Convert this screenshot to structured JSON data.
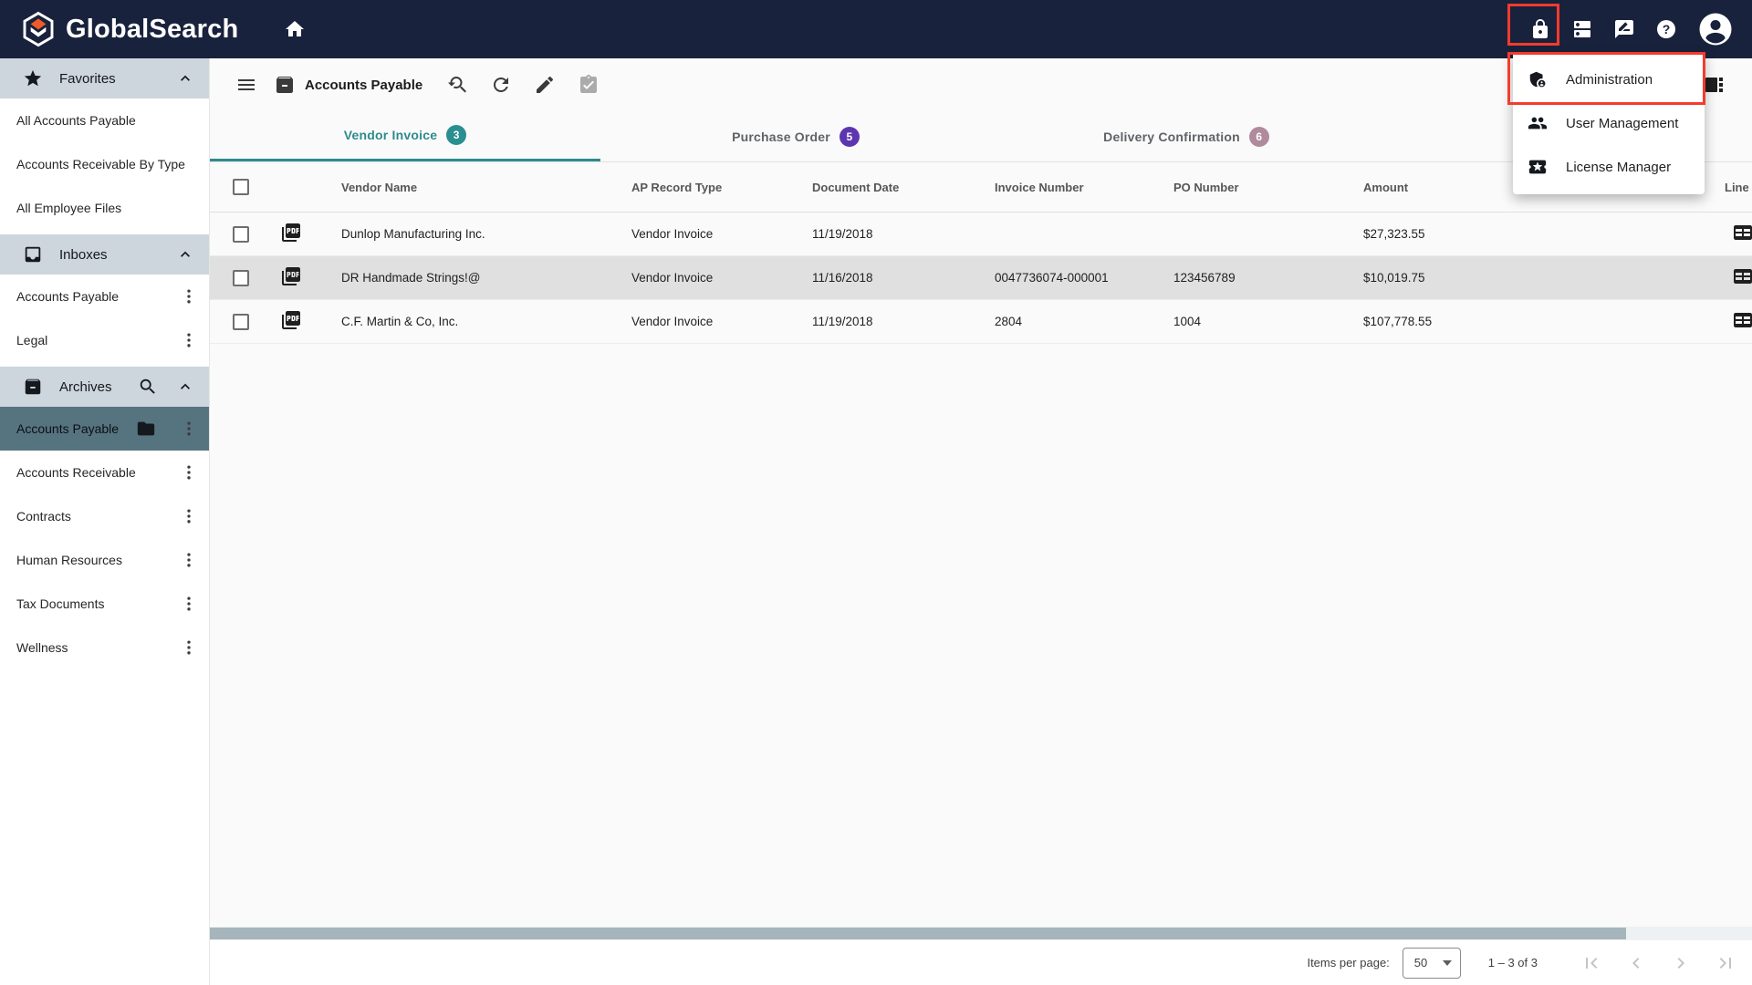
{
  "colors": {
    "topbar_navy": "#19223C",
    "accent_teal": "#2E8B8D",
    "badge_purple": "#5E35B1",
    "badge_mauve": "#B08B9B",
    "annotation_red": "#F43B2E",
    "selected_sidebar_item": "#567380",
    "section_header_bg": "#CDD6DD",
    "row_highlight": "#E0E0E0",
    "scrollbar_thumb": "#A6B5BC"
  },
  "topbar": {
    "brand": "GlobalSearch"
  },
  "account_menu": {
    "items": [
      {
        "label": "Administration",
        "icon": "admin-shield-icon",
        "annotated": true
      },
      {
        "label": "User Management",
        "icon": "user-group-icon"
      },
      {
        "label": "License Manager",
        "icon": "license-ticket-icon"
      }
    ]
  },
  "sidebar": {
    "favorites": {
      "label": "Favorites",
      "items": [
        "All Accounts Payable",
        "Accounts Receivable By Type",
        "All Employee Files"
      ]
    },
    "inboxes": {
      "label": "Inboxes",
      "items": [
        "Accounts Payable",
        "Legal"
      ]
    },
    "archives": {
      "label": "Archives",
      "selected": "Accounts Payable",
      "items": [
        "Accounts Payable",
        "Accounts Receivable",
        "Contracts",
        "Human Resources",
        "Tax Documents",
        "Wellness"
      ]
    }
  },
  "toolbar": {
    "title": "Accounts Payable"
  },
  "tabs": [
    {
      "label": "Vendor Invoice",
      "count": "3",
      "active": true
    },
    {
      "label": "Purchase Order",
      "count": "5",
      "active": false
    },
    {
      "label": "Delivery Confirmation",
      "count": "6",
      "active": false
    }
  ],
  "table": {
    "columns": [
      "Vendor Name",
      "AP Record Type",
      "Document Date",
      "Invoice Number",
      "PO Number",
      "Amount",
      "Line Items"
    ],
    "rows": [
      {
        "vendor": "Dunlop Manufacturing Inc.",
        "record_type": "Vendor Invoice",
        "document_date": "11/19/2018",
        "invoice_number": "",
        "po_number": "",
        "amount": "$27,323.55",
        "highlighted": false
      },
      {
        "vendor": "DR Handmade Strings!@",
        "record_type": "Vendor Invoice",
        "document_date": "11/16/2018",
        "invoice_number": "0047736074-000001",
        "po_number": "123456789",
        "amount": "$10,019.75",
        "highlighted": true
      },
      {
        "vendor": "C.F. Martin & Co, Inc.",
        "record_type": "Vendor Invoice",
        "document_date": "11/19/2018",
        "invoice_number": "2804",
        "po_number": "1004",
        "amount": "$107,778.55",
        "highlighted": false
      }
    ]
  },
  "pagination": {
    "items_per_page_label": "Items per page:",
    "items_per_page_value": "50",
    "range_label": "1 – 3 of 3"
  }
}
